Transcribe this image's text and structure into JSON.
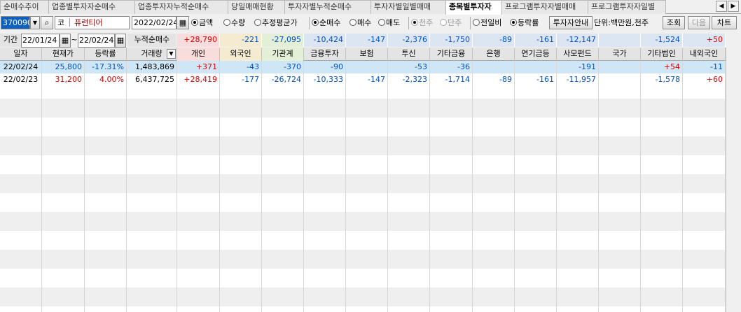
{
  "tabs": [
    "순매수추이",
    "업종별투자자순매수",
    "업종투자자누적순매수",
    "당일매매현황",
    "투자자별누적순매수",
    "투자자별일별매매",
    "종목별투자자",
    "프로그램투자자별매매",
    "프로그램투자자일별"
  ],
  "active_tab": 6,
  "tab_nav": {
    "prev": "◀",
    "next": "▶"
  },
  "toolbar": {
    "stock_code": "370090",
    "market_prefix": "코",
    "stock_name": "퓨런티어",
    "date": "2022/02/24",
    "calendar_icon": "▦",
    "search_icon": "⌕",
    "dropdown_icon": "▼",
    "radio_amount": "금액",
    "radio_qty": "수량",
    "radio_est": "추정평균가",
    "radio_net": "순매수",
    "radio_buy": "매수",
    "radio_sell": "매도",
    "radio_thousand": "천주",
    "radio_single": "단주",
    "radio_prevday": "전일비",
    "radio_rate": "등락률",
    "guide_button": "투자자안내",
    "unit_label": "단위:백만원,천주",
    "query_button": "조회",
    "next_button": "다음",
    "chart_button": "차트"
  },
  "summary": {
    "period_label": "기간",
    "from_date": "22/01/24",
    "tilde": "~",
    "to_date": "22/02/24",
    "cum_label": "누적순매수",
    "values": [
      "+28,790",
      "-221",
      "-27,095",
      "-10,424",
      "-147",
      "-2,376",
      "-1,750",
      "-89",
      "-161",
      "-12,147",
      "",
      "-1,524",
      "+50"
    ]
  },
  "columns": [
    "일자",
    "현재가",
    "등락률",
    "거래량",
    "개인",
    "외국인",
    "기관계",
    "금융투자",
    "보험",
    "투신",
    "기타금융",
    "은행",
    "연기금등",
    "사모펀드",
    "국가",
    "기타법인",
    "내외국인"
  ],
  "rows": [
    [
      "22/02/24",
      "25,800",
      "-17.31%",
      "1,483,869",
      "+371",
      "-43",
      "-370",
      "-90",
      "",
      "-53",
      "-36",
      "",
      "",
      "-191",
      "",
      "+54",
      "-11"
    ],
    [
      "22/02/23",
      "31,200",
      "4.00%",
      "6,437,725",
      "+28,419",
      "-177",
      "-26,724",
      "-10,333",
      "-147",
      "-2,323",
      "-1,714",
      "-89",
      "-161",
      "-11,957",
      "",
      "-1,578",
      "+60"
    ]
  ],
  "colors": {
    "positive": "#e00000",
    "negative": "#0050c8",
    "selected_row": "#cfe6f6",
    "cum_individual_bg": "#f9dcdc",
    "cum_foreign_bg": "#f4ebd0",
    "cum_inst_bg": "#e3efd6",
    "cum_other_bg": "#dce6f2",
    "code_highlight": "#1060c0"
  }
}
